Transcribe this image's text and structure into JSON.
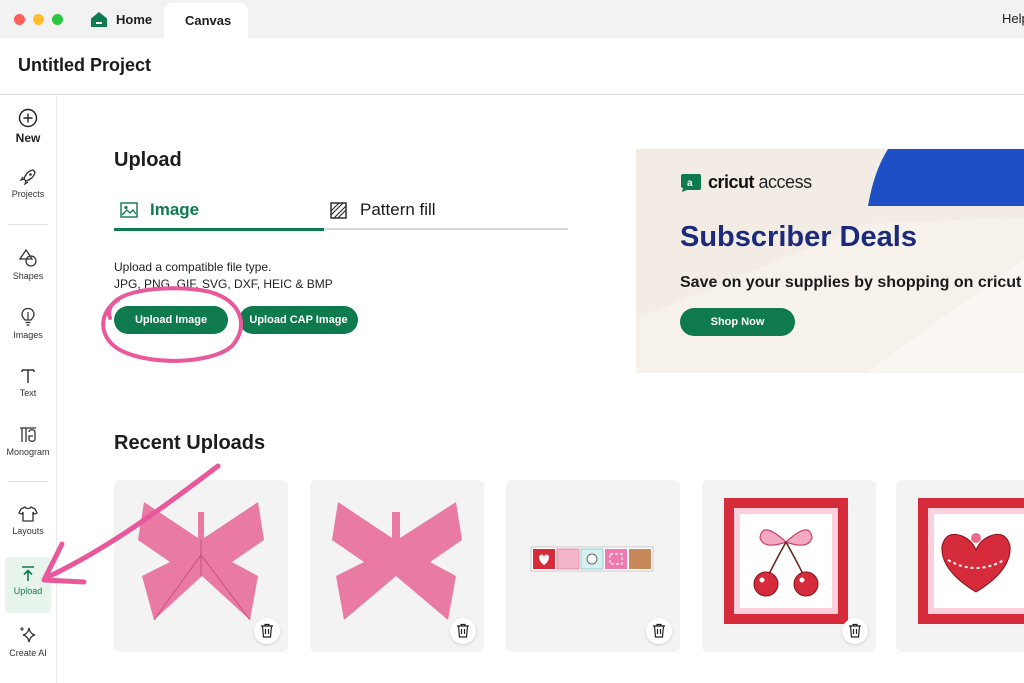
{
  "window": {
    "tabs": [
      {
        "label": "Home",
        "icon": "home-icon"
      },
      {
        "label": "Canvas"
      }
    ],
    "help_label": "Help"
  },
  "project": {
    "title": "Untitled Project"
  },
  "sidebar": {
    "items": [
      {
        "label": "New",
        "icon": "plus-circle-icon"
      },
      {
        "label": "Projects",
        "icon": "rocket-icon"
      },
      {
        "label": "Shapes",
        "icon": "shapes-icon"
      },
      {
        "label": "Images",
        "icon": "lightbulb-icon"
      },
      {
        "label": "Text",
        "icon": "text-icon"
      },
      {
        "label": "Monogram",
        "icon": "monogram-icon"
      },
      {
        "label": "Layouts",
        "icon": "shirt-icon"
      },
      {
        "label": "Upload",
        "icon": "upload-icon",
        "active": true
      },
      {
        "label": "Create AI",
        "icon": "sparkle-icon"
      }
    ]
  },
  "upload": {
    "title": "Upload",
    "tabs": [
      {
        "label": "Image",
        "icon": "image-icon",
        "active": true
      },
      {
        "label": "Pattern fill",
        "icon": "pattern-icon"
      }
    ],
    "description": "Upload a compatible file type.",
    "file_types": "JPG, PNG, GIF, SVG, DXF, HEIC & BMP",
    "upload_image_label": "Upload Image",
    "upload_cap_label": "Upload CAP Image"
  },
  "promo": {
    "brand_name": "cricut",
    "brand_suffix": "access",
    "headline": "Subscriber Deals",
    "subtext": "Save on your supplies by shopping on cricut",
    "button_label": "Shop Now",
    "colors": {
      "background": "#f3ece4",
      "headline": "#1b2a7a",
      "accent": "#1f4fc4",
      "button": "#0e7a4e"
    }
  },
  "recent": {
    "title": "Recent Uploads",
    "items": [
      {
        "thumbnail": "pink-butterfly-outline"
      },
      {
        "thumbnail": "pink-butterfly"
      },
      {
        "thumbnail": "stamp-strip"
      },
      {
        "thumbnail": "cherry-bow-stamp"
      },
      {
        "thumbnail": "heart-cake-stamp"
      }
    ]
  },
  "theme": {
    "primary_green": "#0e7a4e",
    "annotation_pink": "#e8589a"
  }
}
